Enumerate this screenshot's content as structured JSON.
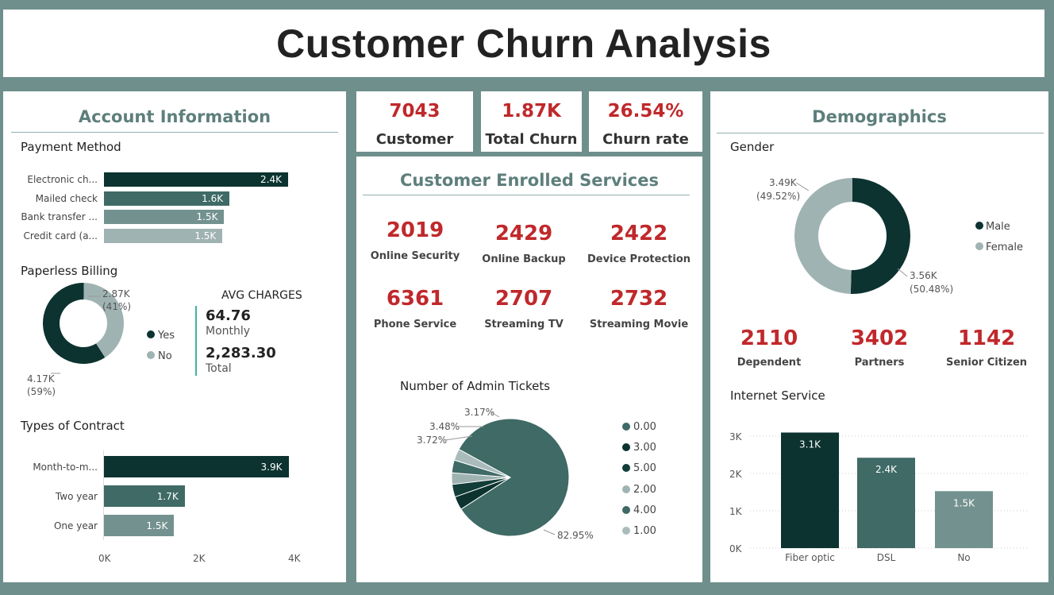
{
  "title": "Customer Churn Analysis",
  "colors": {
    "dark": "#0c3330",
    "mid": "#3f6a66",
    "light": "#9fb3b2",
    "lighter": "#73928f",
    "red": "#c0282b"
  },
  "account": {
    "title": "Account Information",
    "payment": {
      "title": "Payment Method",
      "items": [
        {
          "label": "Electronic ch...",
          "value_label": "2.4K"
        },
        {
          "label": "Mailed check",
          "value_label": "1.6K"
        },
        {
          "label": "Bank transfer ...",
          "value_label": "1.5K"
        },
        {
          "label": "Credit card (a...",
          "value_label": "1.5K"
        }
      ]
    },
    "paperless": {
      "title": "Paperless Billing",
      "yes_value": "4.17K",
      "yes_pct": "(59%)",
      "no_value": "2.87K",
      "no_pct": "(41%)",
      "legend_yes": "Yes",
      "legend_no": "No"
    },
    "avg": {
      "title": "AVG CHARGES",
      "monthly_value": "64.76",
      "monthly_label": "Monthly",
      "total_value": "2,283.30",
      "total_label": "Total"
    },
    "contract": {
      "title": "Types of Contract",
      "items": [
        {
          "label": "Month-to-m...",
          "value_label": "3.9K"
        },
        {
          "label": "Two year",
          "value_label": "1.7K"
        },
        {
          "label": "One year",
          "value_label": "1.5K"
        }
      ],
      "ticks": [
        "0K",
        "2K",
        "4K"
      ]
    }
  },
  "kpis": [
    {
      "value": "7043",
      "label": "Customer"
    },
    {
      "value": "1.87K",
      "label": "Total Churn"
    },
    {
      "value": "26.54%",
      "label": "Churn rate"
    }
  ],
  "services": {
    "title": "Customer Enrolled Services",
    "items": [
      {
        "value": "2019",
        "label": "Online Security"
      },
      {
        "value": "2429",
        "label": "Online Backup"
      },
      {
        "value": "2422",
        "label": "Device Protection"
      },
      {
        "value": "6361",
        "label": "Phone Service"
      },
      {
        "value": "2707",
        "label": "Streaming TV"
      },
      {
        "value": "2732",
        "label": "Streaming Movie"
      }
    ],
    "tickets_title": "Number of Admin Tickets",
    "pie_labels": {
      "big": "82.95%",
      "a": "3.17%",
      "b": "3.48%",
      "c": "3.72%"
    },
    "legend": [
      "0.00",
      "3.00",
      "5.00",
      "2.00",
      "4.00",
      "1.00"
    ]
  },
  "demographics": {
    "title": "Demographics",
    "gender_title": "Gender",
    "female_value": "3.49K",
    "female_pct": "(49.52%)",
    "male_value": "3.56K",
    "male_pct": "(50.48%)",
    "legend_male": "Male",
    "legend_female": "Female",
    "stats": [
      {
        "value": "2110",
        "label": "Dependent"
      },
      {
        "value": "3402",
        "label": "Partners"
      },
      {
        "value": "1142",
        "label": "Senior Citizen"
      }
    ],
    "internet_title": "Internet Service",
    "y_ticks": [
      "3K",
      "2K",
      "1K",
      "0K"
    ]
  },
  "chart_data": [
    {
      "type": "bar",
      "title": "Payment Method",
      "categories": [
        "Electronic ch...",
        "Mailed check",
        "Bank transfer ...",
        "Credit card (a..."
      ],
      "values": [
        2365,
        1612,
        1544,
        1522
      ]
    },
    {
      "type": "pie",
      "title": "Paperless Billing",
      "categories": [
        "Yes",
        "No"
      ],
      "values": [
        4171,
        2872
      ]
    },
    {
      "type": "bar",
      "title": "Types of Contract",
      "categories": [
        "Month-to-m...",
        "Two year",
        "One year"
      ],
      "values": [
        3875,
        1695,
        1473
      ],
      "xlim": [
        0,
        4000
      ]
    },
    {
      "type": "pie",
      "title": "Number of Admin Tickets",
      "categories": [
        "0.00",
        "3.00",
        "5.00",
        "2.00",
        "4.00",
        "1.00"
      ],
      "values": [
        82.95,
        3.72,
        3.48,
        3.17,
        3.5,
        3.18
      ]
    },
    {
      "type": "pie",
      "title": "Gender",
      "categories": [
        "Male",
        "Female"
      ],
      "values": [
        3555,
        3488
      ]
    },
    {
      "type": "bar",
      "title": "Internet Service",
      "categories": [
        "Fiber optic",
        "DSL",
        "No"
      ],
      "values": [
        3096,
        2421,
        1526
      ],
      "value_labels": [
        "3.1K",
        "2.4K",
        "1.5K"
      ],
      "ylim": [
        0,
        3000
      ]
    }
  ]
}
